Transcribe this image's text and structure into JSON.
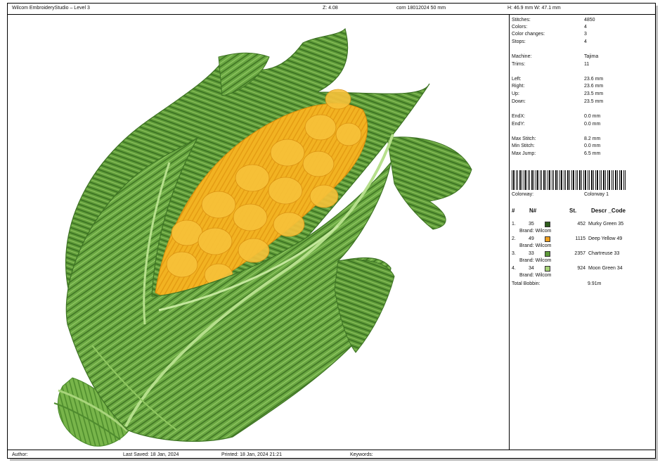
{
  "header": {
    "app_title": "Wilcom EmbroideryStudio – Level 3",
    "zoom": "Z: 4.08",
    "file": "corn 18012024 50 mm",
    "size": "H: 46.9 mm   W: 47.1 mm"
  },
  "stats": [
    {
      "label": "Stitches:",
      "value": "4850"
    },
    {
      "label": "Colors:",
      "value": "4"
    },
    {
      "label": "Color changes:",
      "value": "3"
    },
    {
      "label": "Stops:",
      "value": "4"
    },
    {
      "label": "Machine:",
      "value": "Tajima"
    },
    {
      "label": "Trims:",
      "value": "11"
    },
    {
      "label": "Left:",
      "value": "23.6 mm"
    },
    {
      "label": "Right:",
      "value": "23.6 mm"
    },
    {
      "label": "Up:",
      "value": "23.5 mm"
    },
    {
      "label": "Down:",
      "value": "23.5 mm"
    },
    {
      "label": "EndX:",
      "value": "0.0 mm"
    },
    {
      "label": "EndY:",
      "value": "0.0 mm"
    },
    {
      "label": "Max Stitch:",
      "value": "8.2 mm"
    },
    {
      "label": "Min Stitch:",
      "value": "0.0 mm"
    },
    {
      "label": "Max Jump:",
      "value": "6.5 mm"
    }
  ],
  "colorway": {
    "label": "Colorway:",
    "value": "Colorway 1"
  },
  "thread_table": {
    "headers": {
      "num": "#",
      "needle": "N#",
      "stitches": "St.",
      "descr": "Descr",
      "code": "Code"
    },
    "rows": [
      {
        "num": "1.",
        "needle": "35",
        "color": "#2f5e1d",
        "stitches": "452",
        "descr": "Murky Green 35",
        "brand": "Brand: Wilcom"
      },
      {
        "num": "2.",
        "needle": "49",
        "color": "#f0a020",
        "stitches": "1115",
        "descr": "Deep Yellow 49",
        "brand": "Brand: Wilcom"
      },
      {
        "num": "3.",
        "needle": "33",
        "color": "#5e9a3a",
        "stitches": "2357",
        "descr": "Chartreuse 33",
        "brand": "Brand: Wilcom"
      },
      {
        "num": "4.",
        "needle": "34",
        "color": "#a6d276",
        "stitches": "924",
        "descr": "Moon Green 34",
        "brand": "Brand: Wilcom"
      }
    ]
  },
  "total_bobbin": {
    "label": "Total Bobbin:",
    "value": "9.91m"
  },
  "footer": {
    "author": "Author:",
    "last_saved": "Last Saved: 18 Jan, 2024",
    "printed": "Printed: 18 Jan, 2024 21:21",
    "keywords": "Keywords:"
  },
  "design": {
    "subject": "corn-embroidery-icon"
  }
}
